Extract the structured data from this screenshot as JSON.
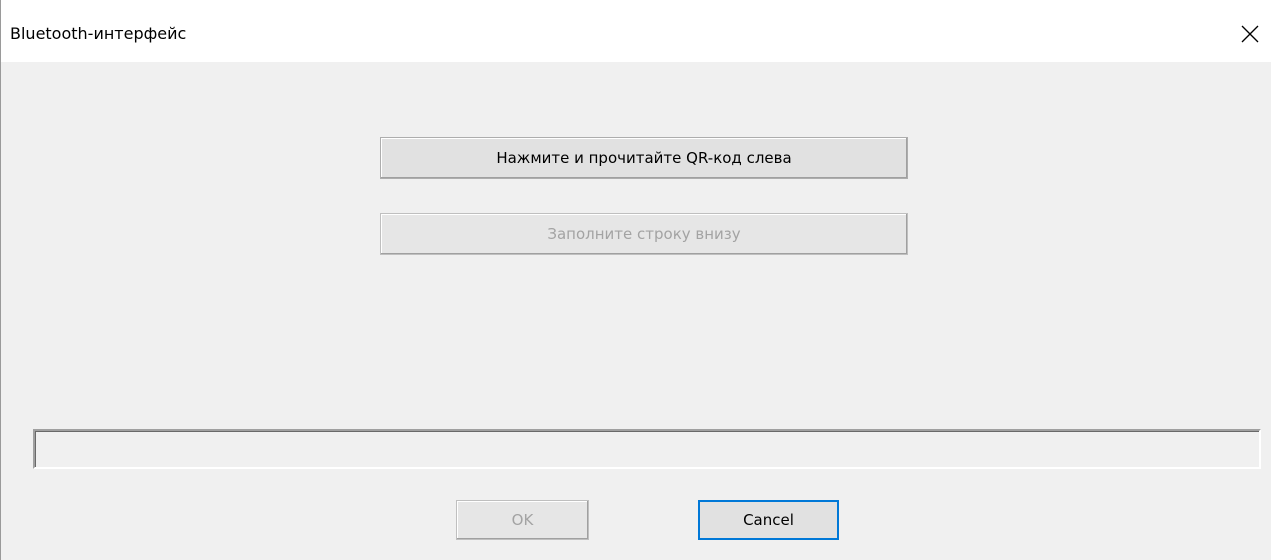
{
  "window": {
    "title": "Bluetooth-интерфейс",
    "close_icon": "close-icon"
  },
  "main": {
    "qr_button_label": "Нажмите и прочитайте QR-код слева",
    "fill_button_label": "Заполните строку внизу",
    "input_value": ""
  },
  "footer": {
    "ok_label": "OK",
    "cancel_label": "Cancel"
  }
}
